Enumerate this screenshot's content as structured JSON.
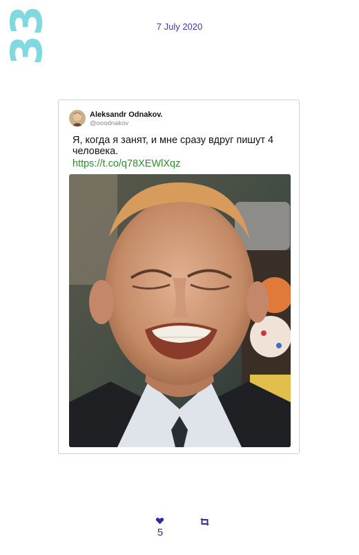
{
  "page": {
    "number": "33",
    "date": "7 July 2020"
  },
  "tweet": {
    "author_name": "Aleksandr Odnakov.",
    "author_handle": "@ooodnakov",
    "text": "Я, когда я занят, и мне сразу вдруг пишут 4 человека.",
    "link": "https://t.co/q78XEWlXqz"
  },
  "footer": {
    "likes": "5",
    "like_icon": "heart-icon",
    "retweet_icon": "retweet-icon"
  },
  "colors": {
    "page_number": "#7fd9de",
    "date": "#3b3fa8",
    "link": "#2e8b2e",
    "footer": "#2a2fa0"
  }
}
